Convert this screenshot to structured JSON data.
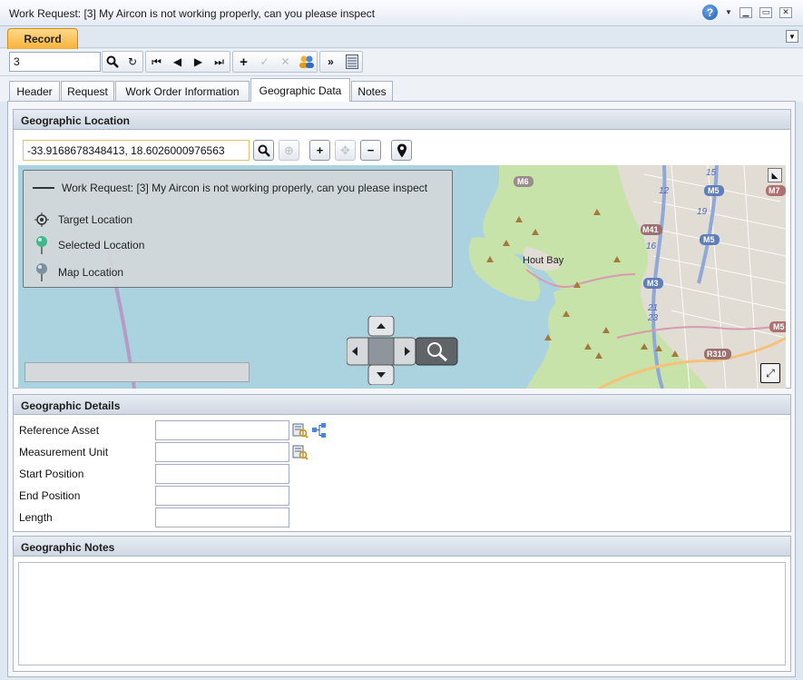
{
  "window": {
    "title": "Work Request: [3] My Aircon is not working properly, can you please inspect"
  },
  "top_tab": {
    "label": "Record"
  },
  "toolbar": {
    "record_value": "3"
  },
  "tabs": [
    {
      "label": "Header"
    },
    {
      "label": "Request"
    },
    {
      "label": "Work Order Information"
    },
    {
      "label": "Geographic Data"
    },
    {
      "label": "Notes"
    }
  ],
  "active_tab": "Geographic Data",
  "geo_location": {
    "heading": "Geographic Location",
    "coordinates": "-33.9168678348413, 18.6026000976563"
  },
  "legend": {
    "line_label": "Work Request: [3] My Aircon is not working properly, can you please inspect",
    "target": "Target Location",
    "selected": "Selected Location",
    "map_location": "Map Location"
  },
  "map": {
    "place": "Hout Bay",
    "route_labels": [
      "M6",
      "M5",
      "M7",
      "M41",
      "M5",
      "M3",
      "M5",
      "R310"
    ],
    "exit_numbers": [
      "15",
      "12",
      "19",
      "16",
      "21",
      "23"
    ]
  },
  "geo_details": {
    "heading": "Geographic Details",
    "reference_asset": "Reference Asset",
    "measurement_unit": "Measurement Unit",
    "start_position": "Start Position",
    "end_position": "End Position",
    "length": "Length"
  },
  "geo_notes": {
    "heading": "Geographic Notes"
  },
  "colors": {
    "record_tab": "#f6b23a",
    "water": "#aad3df",
    "park": "#c8e3a9",
    "urban": "#e1dcd4"
  }
}
